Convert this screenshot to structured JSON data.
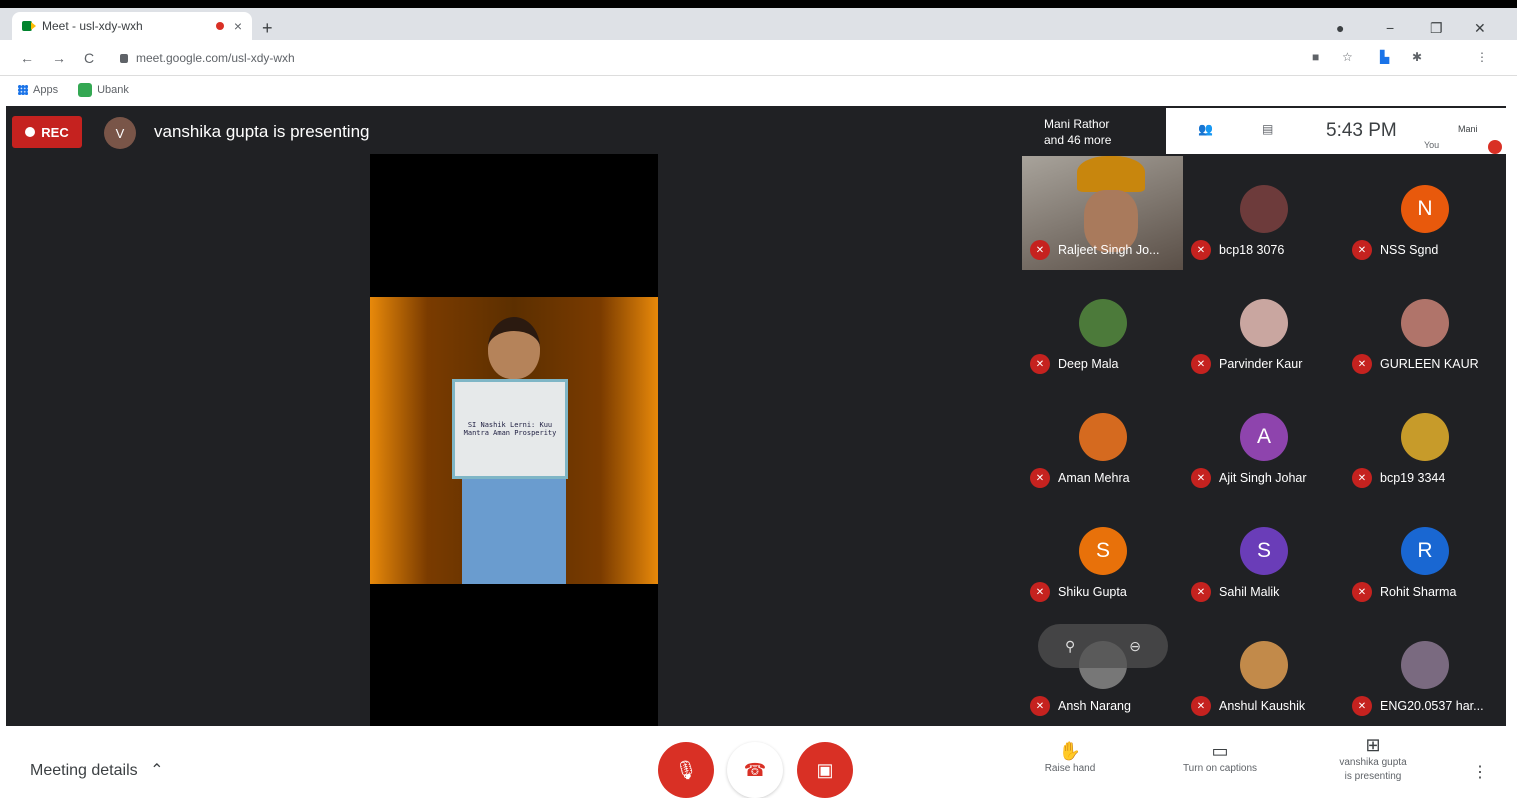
{
  "browser": {
    "tab_title": "Meet - usl-xdy-wxh",
    "tab_close": "×",
    "new_tab": "+",
    "window_controls": [
      "−",
      "❐",
      "✕"
    ],
    "nav_back": "←",
    "nav_forward": "→",
    "nav_reload": "C",
    "url": "meet.google.com/usl-xdy-wxh",
    "bookmarks": [
      "Apps",
      "Ubank"
    ]
  },
  "meeting": {
    "rec_label": "REC",
    "presenter_initial": "V",
    "presenting_text": "vanshika gupta is presenting",
    "placard_text": "SI Nashik Lerni: Kuu Mantra Aman Prosperity",
    "participants_summary": [
      "Mani Rathor",
      "and 46 more"
    ],
    "time": "5:43 PM",
    "self_label": "You",
    "self_name": "Mani"
  },
  "participants": [
    {
      "name": "Raljeet Singh Jo...",
      "kind": "video"
    },
    {
      "name": "bcp18 3076",
      "kind": "photo",
      "color": "#6d3b3b"
    },
    {
      "name": "NSS Sgnd",
      "kind": "initial",
      "initial": "N",
      "color": "#e8590c"
    },
    {
      "name": "Deep Mala",
      "kind": "photo",
      "color": "#4c7a3a"
    },
    {
      "name": "Parvinder Kaur",
      "kind": "photo",
      "color": "#c9a6a0"
    },
    {
      "name": "GURLEEN KAUR",
      "kind": "photo",
      "color": "#b0746a"
    },
    {
      "name": "Aman Mehra",
      "kind": "photo",
      "color": "#d56a1f"
    },
    {
      "name": "Ajit Singh Johar",
      "kind": "initial",
      "initial": "A",
      "color": "#8e44ad"
    },
    {
      "name": "bcp19 3344",
      "kind": "photo",
      "color": "#c79b2a"
    },
    {
      "name": "Shiku Gupta",
      "kind": "initial",
      "initial": "S",
      "color": "#e8710a"
    },
    {
      "name": "Sahil Malik",
      "kind": "initial",
      "initial": "S",
      "color": "#6a3db8"
    },
    {
      "name": "Rohit Sharma",
      "kind": "initial",
      "initial": "R",
      "color": "#1967d2"
    },
    {
      "name": "Ansh Narang",
      "kind": "photo",
      "color": "#777777"
    },
    {
      "name": "Anshul Kaushik",
      "kind": "photo",
      "color": "#c28a4a"
    },
    {
      "name": "ENG20.0537 har...",
      "kind": "photo",
      "color": "#7a6a80"
    }
  ],
  "controls": {
    "meeting_details": "Meeting details",
    "raise_hand": "Raise hand",
    "captions": "Turn on captions",
    "presenting": [
      "vanshika gupta",
      "is presenting"
    ]
  },
  "colors": {
    "accent_red": "#d93025",
    "dark_bg": "#202124"
  }
}
